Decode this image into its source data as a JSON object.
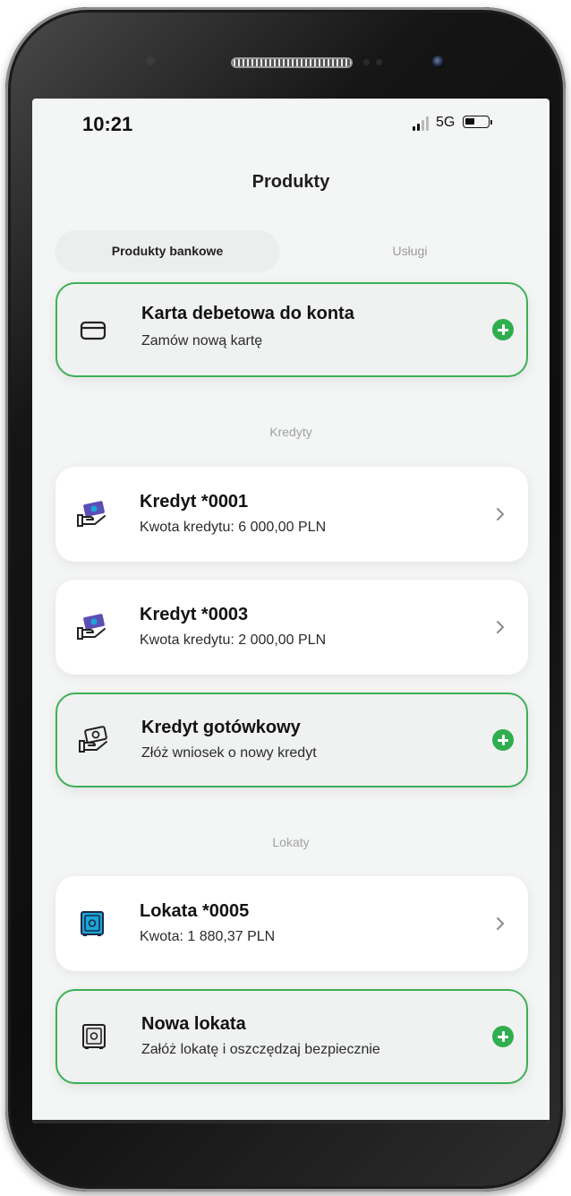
{
  "status_bar": {
    "time": "10:21",
    "network": "5G",
    "signal_bars_active": 2,
    "signal_bars_total": 4,
    "battery_level": 0.3
  },
  "header": {
    "title": "Produkty"
  },
  "tabs": [
    {
      "label": "Produkty bankowe",
      "active": true
    },
    {
      "label": "Usługi",
      "active": false
    }
  ],
  "debit_card": {
    "title": "Karta debetowa do konta",
    "subtitle": "Zamów nową kartę",
    "icon": "credit-card-icon",
    "action_icon": "plus-circle-icon"
  },
  "credits_section": {
    "label": "Kredyty",
    "items": [
      {
        "title": "Kredyt *0001",
        "subtitle": "Kwota kredytu: 6 000,00 PLN",
        "icon": "hand-money-icon",
        "action_icon": "chevron-right-icon"
      },
      {
        "title": "Kredyt *0003",
        "subtitle": "Kwota kredytu: 2 000,00 PLN",
        "icon": "hand-money-icon",
        "action_icon": "chevron-right-icon"
      }
    ],
    "new_item": {
      "title": "Kredyt gotówkowy",
      "subtitle": "Złóż wniosek o nowy kredyt",
      "icon": "hand-money-icon",
      "action_icon": "plus-circle-icon"
    }
  },
  "deposits_section": {
    "label": "Lokaty",
    "items": [
      {
        "title": "Lokata *0005",
        "subtitle": "Kwota: 1 880,37 PLN",
        "icon": "safe-icon",
        "action_icon": "chevron-right-icon"
      }
    ],
    "new_item": {
      "title": "Nowa lokata",
      "subtitle": "Załóż lokatę i oszczędzaj bezpiecznie",
      "icon": "safe-icon",
      "action_icon": "plus-circle-icon"
    }
  },
  "colors": {
    "accent_green": "#2eae4f",
    "outline_green": "#3cb155",
    "icon_blue": "#1aa6d6",
    "icon_purple": "#5b4fb5"
  }
}
